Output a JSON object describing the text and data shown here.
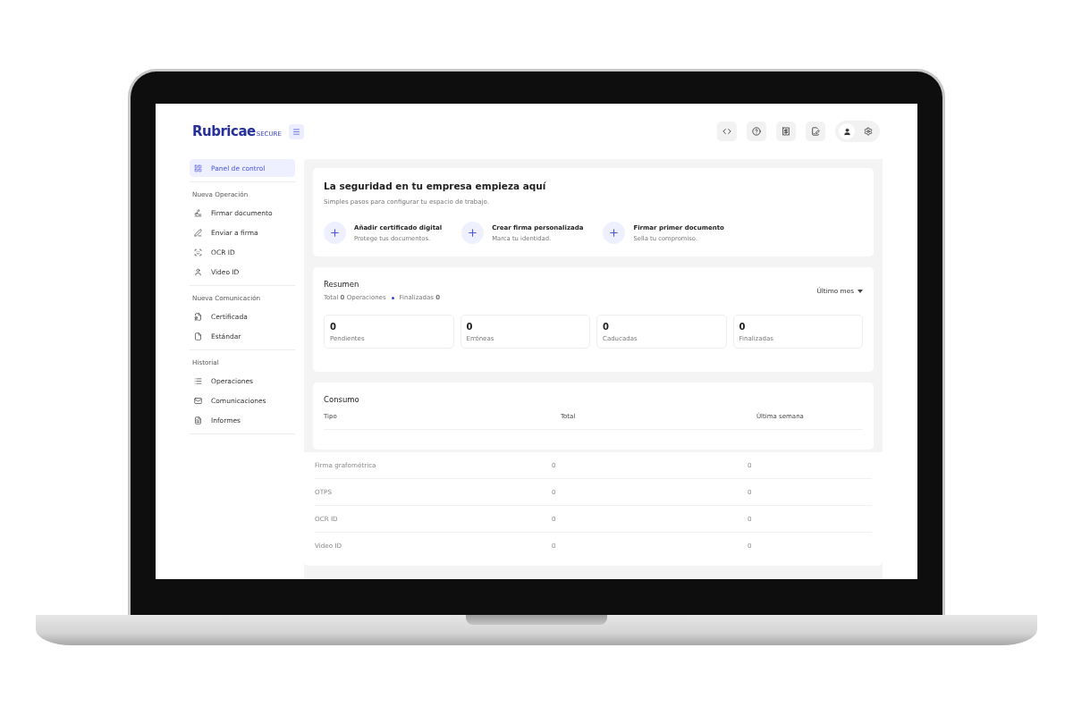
{
  "logo": {
    "name": "Rubricae",
    "tag": "SECURE"
  },
  "sidebar": {
    "top": [
      {
        "label": "Panel de control",
        "selected": true
      }
    ],
    "sections": [
      {
        "title": "Nueva Operación",
        "items": [
          {
            "label": "Firmar documento",
            "selected": false
          },
          {
            "label": "Enviar a firma",
            "selected": false
          },
          {
            "label": "OCR ID",
            "selected": false
          },
          {
            "label": "Video ID",
            "selected": false
          }
        ]
      },
      {
        "title": "Nueva Comunicación",
        "items": [
          {
            "label": "Certificada",
            "selected": false
          },
          {
            "label": "Estándar",
            "selected": false
          }
        ]
      },
      {
        "title": "Historial",
        "items": [
          {
            "label": "Operaciones",
            "selected": false
          },
          {
            "label": "Comunicaciones",
            "selected": false
          },
          {
            "label": "Informes",
            "selected": false
          }
        ]
      }
    ]
  },
  "welcome": {
    "title": "La seguridad en tu empresa empieza aquí",
    "subtitle": "Simples pasos para configurar tu espacio de trabajo.",
    "steps": [
      {
        "title": "Añadir certificado digital",
        "text": "Protege tus documentos."
      },
      {
        "title": "Crear firma personalizada",
        "text": "Marca tu identidad."
      },
      {
        "title": "Firmar primer documento",
        "text": "Sella tu compromiso."
      }
    ]
  },
  "summary": {
    "title": "Resumen",
    "totals": "Total **0** Operaciones",
    "finished": "Finalizadas **0**",
    "period": "Último mes",
    "stats": [
      {
        "value": "0",
        "label": "Pendientes"
      },
      {
        "value": "0",
        "label": "Erróneas"
      },
      {
        "value": "0",
        "label": "Caducadas"
      },
      {
        "value": "0",
        "label": "Finalizadas"
      }
    ]
  },
  "consumption": {
    "title": "Consumo",
    "columns": [
      "Tipo",
      "Total",
      "Última semana"
    ],
    "rows": [
      [
        "Firma grafométrica",
        "0",
        "0"
      ],
      [
        "OTPS",
        "0",
        "0"
      ],
      [
        "OCR ID",
        "0",
        "0"
      ],
      [
        "Video ID",
        "0",
        "0"
      ]
    ]
  }
}
